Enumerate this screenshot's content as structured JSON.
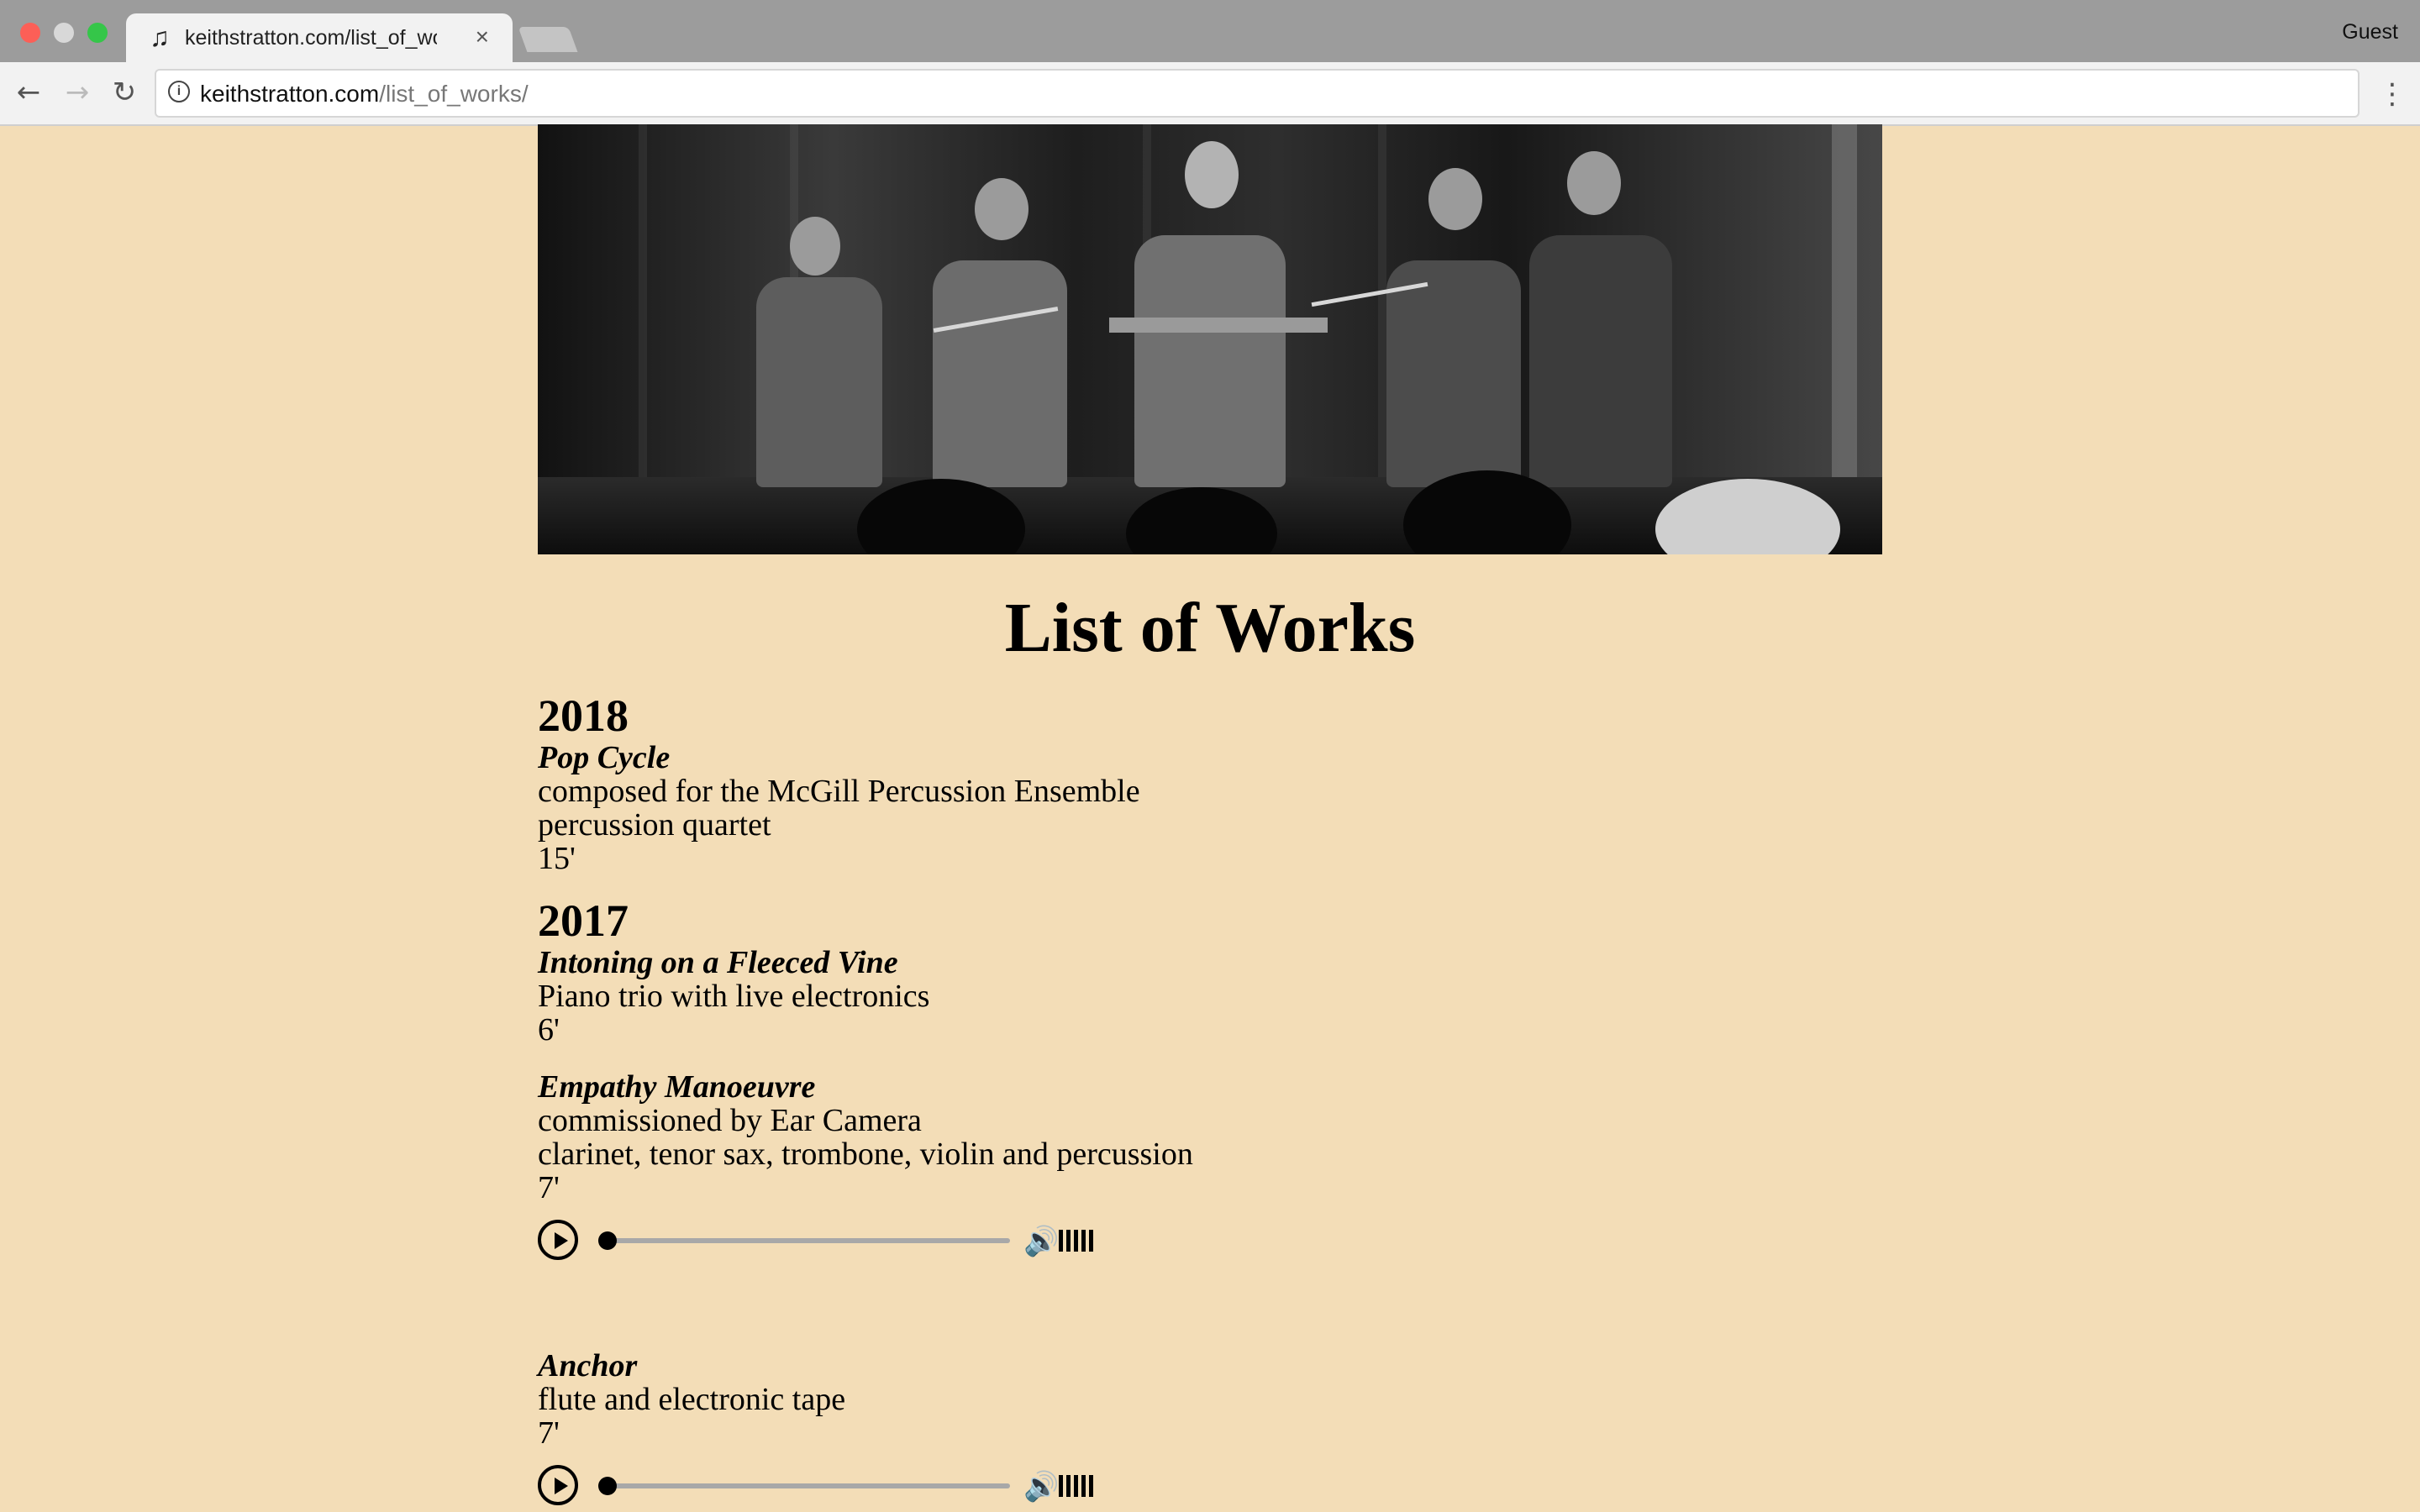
{
  "browser": {
    "tab_title": "keithstratton.com/list_of_works/",
    "tab_icon": "music-note-icon",
    "profile": "Guest",
    "url_host": "keithstratton.com",
    "url_path": "/list_of_works/"
  },
  "page": {
    "heading": "List of Works",
    "years": [
      {
        "year": "2018",
        "works": [
          {
            "title": "Pop Cycle",
            "lines": [
              "composed for the McGill Percussion Ensemble",
              "percussion quartet",
              "15'"
            ]
          }
        ]
      },
      {
        "year": "2017",
        "works": [
          {
            "title": "Intoning on a Fleeced Vine",
            "lines": [
              "Piano trio with live electronics",
              "6'"
            ]
          },
          {
            "title": "Empathy Manoeuvre",
            "lines": [
              "commissioned by Ear Camera",
              "clarinet, tenor sax, trombone, violin and percussion",
              "7'"
            ],
            "audio": {
              "progress": 0.0,
              "volume": 1.0
            }
          },
          {
            "title": "Anchor",
            "lines": [
              "flute and electronic tape",
              "7'"
            ],
            "audio": {
              "progress": 0.0,
              "volume": 1.0
            }
          }
        ]
      }
    ]
  },
  "colors": {
    "page_background": "#f3ddb7",
    "text": "#000000"
  }
}
